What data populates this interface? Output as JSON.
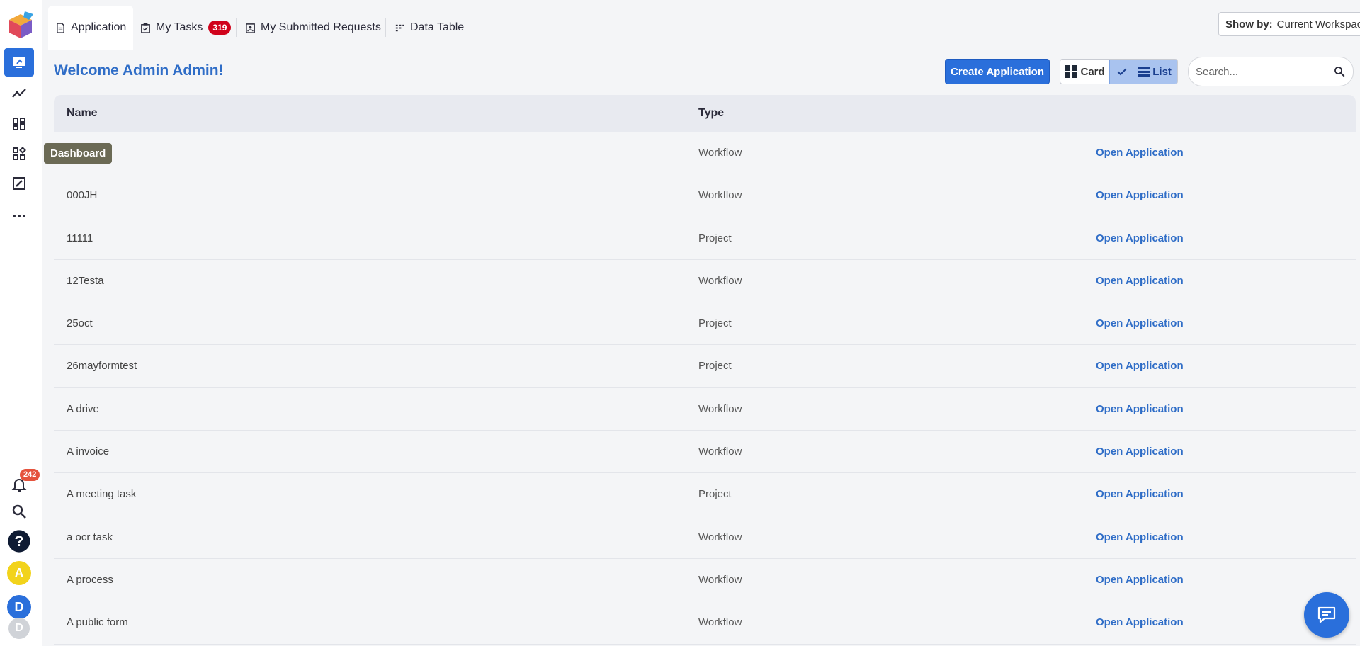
{
  "sidebar": {
    "tooltip": "Dashboard",
    "notification_count": "242",
    "avatars": [
      "A",
      "D",
      "D"
    ]
  },
  "tabs": [
    {
      "label": "Application",
      "icon": "document-icon"
    },
    {
      "label": "My Tasks",
      "icon": "tasks-icon",
      "badge": "319"
    },
    {
      "label": "My Submitted Requests",
      "icon": "requests-icon"
    },
    {
      "label": "Data Table",
      "icon": "data-table-icon"
    }
  ],
  "show_by": {
    "label": "Show by:",
    "value": "Current Workspace"
  },
  "welcome": "Welcome Admin Admin!",
  "create_button": "Create Application",
  "view_toggle": {
    "card": "Card",
    "list": "List",
    "selected": "List"
  },
  "search": {
    "placeholder": "Search..."
  },
  "table": {
    "headers": {
      "name": "Name",
      "type": "Type"
    },
    "action_label": "Open Application",
    "rows": [
      {
        "name": "",
        "type": "Workflow"
      },
      {
        "name": "000JH",
        "type": "Workflow"
      },
      {
        "name": "11111",
        "type": "Project"
      },
      {
        "name": "12Testa",
        "type": "Workflow"
      },
      {
        "name": "25oct",
        "type": "Project"
      },
      {
        "name": "26mayformtest",
        "type": "Project"
      },
      {
        "name": "A drive",
        "type": "Workflow"
      },
      {
        "name": "A invoice",
        "type": "Workflow"
      },
      {
        "name": "A meeting task",
        "type": "Project"
      },
      {
        "name": "a ocr task",
        "type": "Workflow"
      },
      {
        "name": "A process",
        "type": "Workflow"
      },
      {
        "name": "A public form",
        "type": "Workflow"
      }
    ]
  },
  "colors": {
    "accent": "#2a6fdb",
    "title": "#2f6dc7",
    "badge": "#d0021b"
  }
}
